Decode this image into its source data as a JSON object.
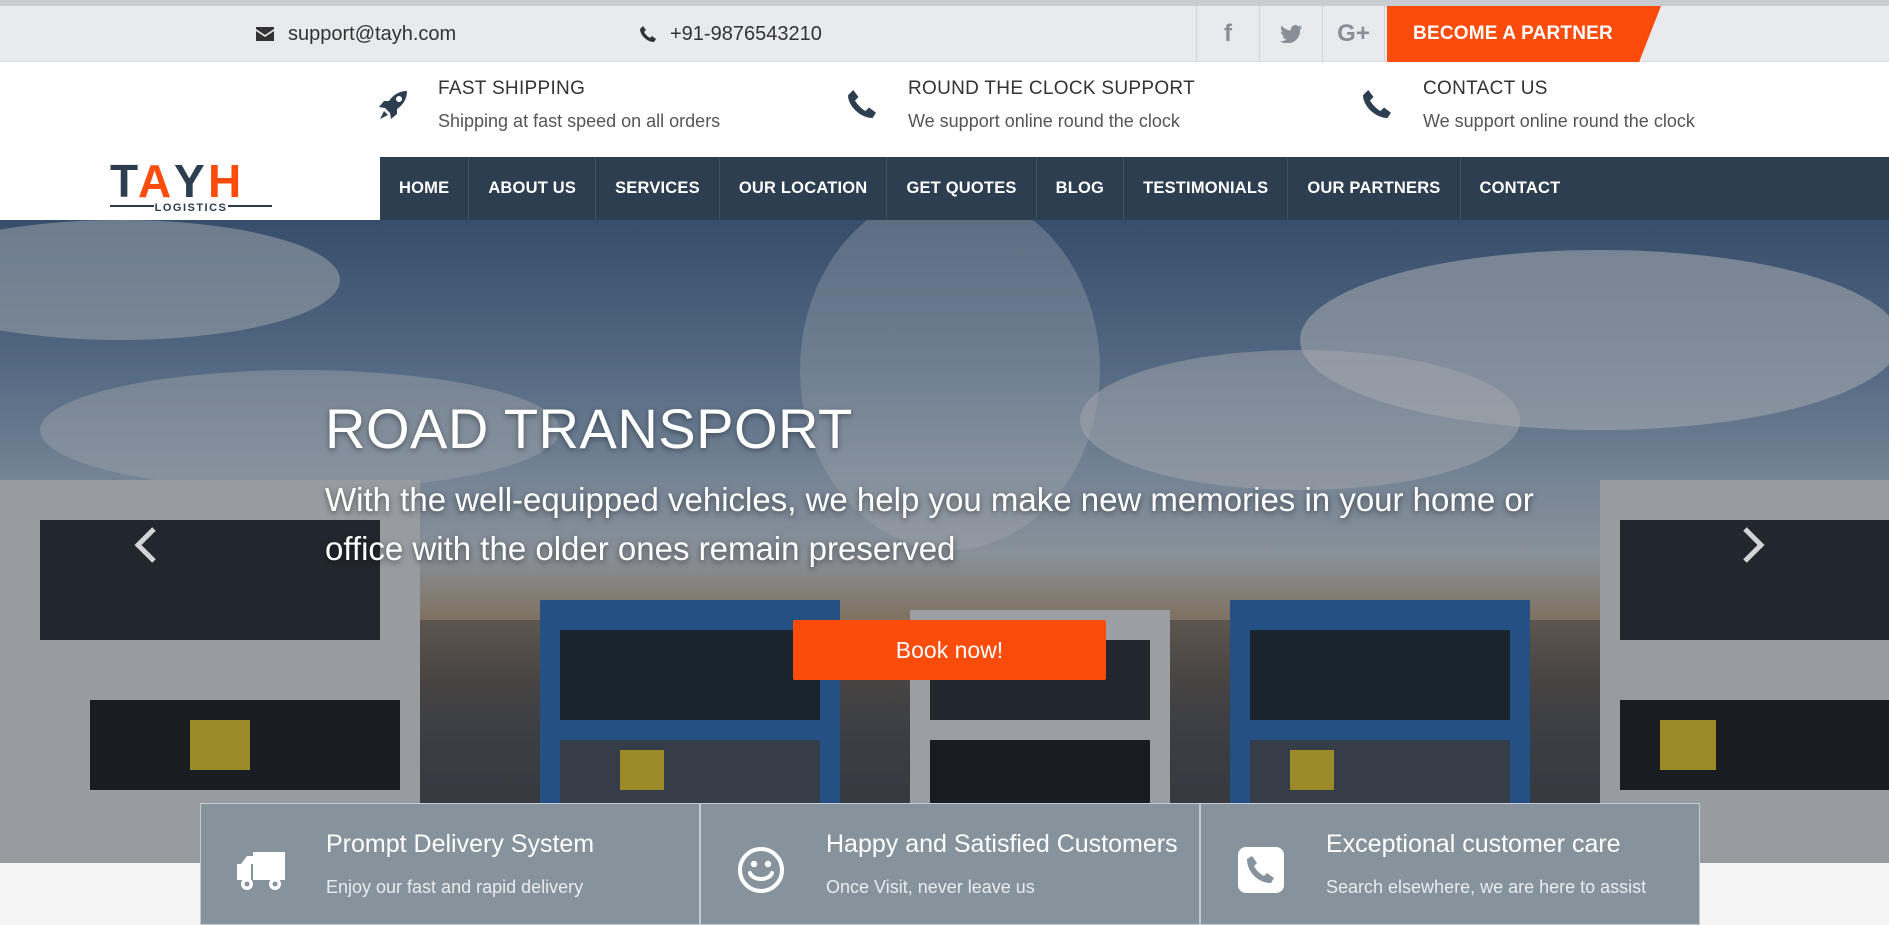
{
  "topbar": {
    "email": "support@tayh.com",
    "phone": "+91-9876543210",
    "social": [
      {
        "icon": "facebook-icon",
        "glyph": "f"
      },
      {
        "icon": "twitter-icon",
        "glyph": "t"
      },
      {
        "icon": "google-plus-icon",
        "glyph": "G+"
      }
    ],
    "partner_label": "BECOME A PARTNER"
  },
  "header": {
    "logo_text": "TAYH",
    "logo_sub": "LOGISTICS",
    "info": [
      {
        "title": "FAST SHIPPING",
        "text": "Shipping at fast speed on all orders",
        "icon": "rocket-icon"
      },
      {
        "title": "ROUND THE CLOCK SUPPORT",
        "text": "We support online round the clock",
        "icon": "phone-icon"
      },
      {
        "title": "CONTACT US",
        "text": "We support online round the clock",
        "icon": "phone-icon"
      }
    ],
    "nav": [
      "HOME",
      "ABOUT US",
      "SERVICES",
      "OUR LOCATION",
      "GET QUOTES",
      "BLOG",
      "TESTIMONIALS",
      "OUR PARTNERS",
      "CONTACT"
    ]
  },
  "hero": {
    "title": "ROAD TRANSPORT",
    "text": "With the well-equipped vehicles, we help you make new memories in your home or office with the older ones remain preserved",
    "button": "Book now!"
  },
  "features": [
    {
      "title": "Prompt Delivery System",
      "text": "Enjoy our fast and rapid delivery",
      "icon": "truck-icon"
    },
    {
      "title": "Happy and Satisfied Customers",
      "text": "Once Visit, never leave us",
      "icon": "smile-icon"
    },
    {
      "title": "Exceptional customer care",
      "text": "Search elsewhere, we are here to assist",
      "icon": "phone-square-icon"
    }
  ],
  "colors": {
    "accent": "#fc4c0c",
    "nav": "#2c3e50"
  }
}
